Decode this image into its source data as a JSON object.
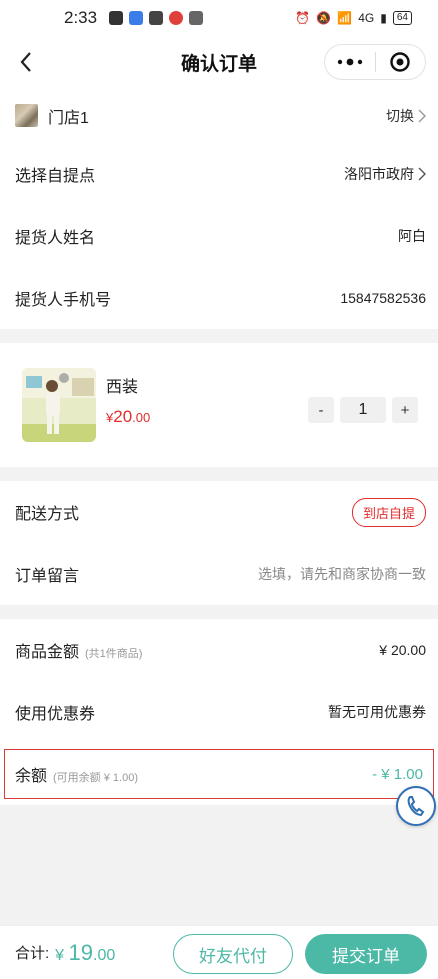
{
  "status_bar": {
    "time": "2:33",
    "network": "4G",
    "battery": "64"
  },
  "nav": {
    "title": "确认订单"
  },
  "store": {
    "name": "门店1",
    "action": "切换"
  },
  "pickup": [
    {
      "label": "选择自提点",
      "value": "洛阳市政府"
    },
    {
      "label": "提货人姓名",
      "value": "阿白"
    },
    {
      "label": "提货人手机号",
      "value": "15847582536"
    }
  ],
  "product": {
    "name": "西装",
    "currency": "¥",
    "price_int": "20",
    "price_dec": ".00",
    "quantity": "1",
    "minus": "-",
    "plus": "+"
  },
  "delivery": {
    "label": "配送方式",
    "value": "到店自提"
  },
  "remark": {
    "label": "订单留言",
    "placeholder": "选填，请先和商家协商一致"
  },
  "summary": {
    "goods_label": "商品金额",
    "goods_note": "(共1件商品)",
    "goods_value": "¥  20.00",
    "coupon_label": "使用优惠券",
    "coupon_value": "暂无可用优惠券",
    "balance_label": "余额",
    "balance_note": "(可用余额 ¥ 1.00)",
    "balance_value": "- ¥ 1.00"
  },
  "bottom": {
    "total_label": "合计:",
    "currency": "¥",
    "total_int": "19",
    "total_dec": ".00",
    "friend_pay": "好友代付",
    "submit": "提交订单"
  },
  "colors": {
    "accent": "#4cb8a6",
    "price_red": "#e02d2d",
    "phone_blue": "#2f6fb2"
  }
}
